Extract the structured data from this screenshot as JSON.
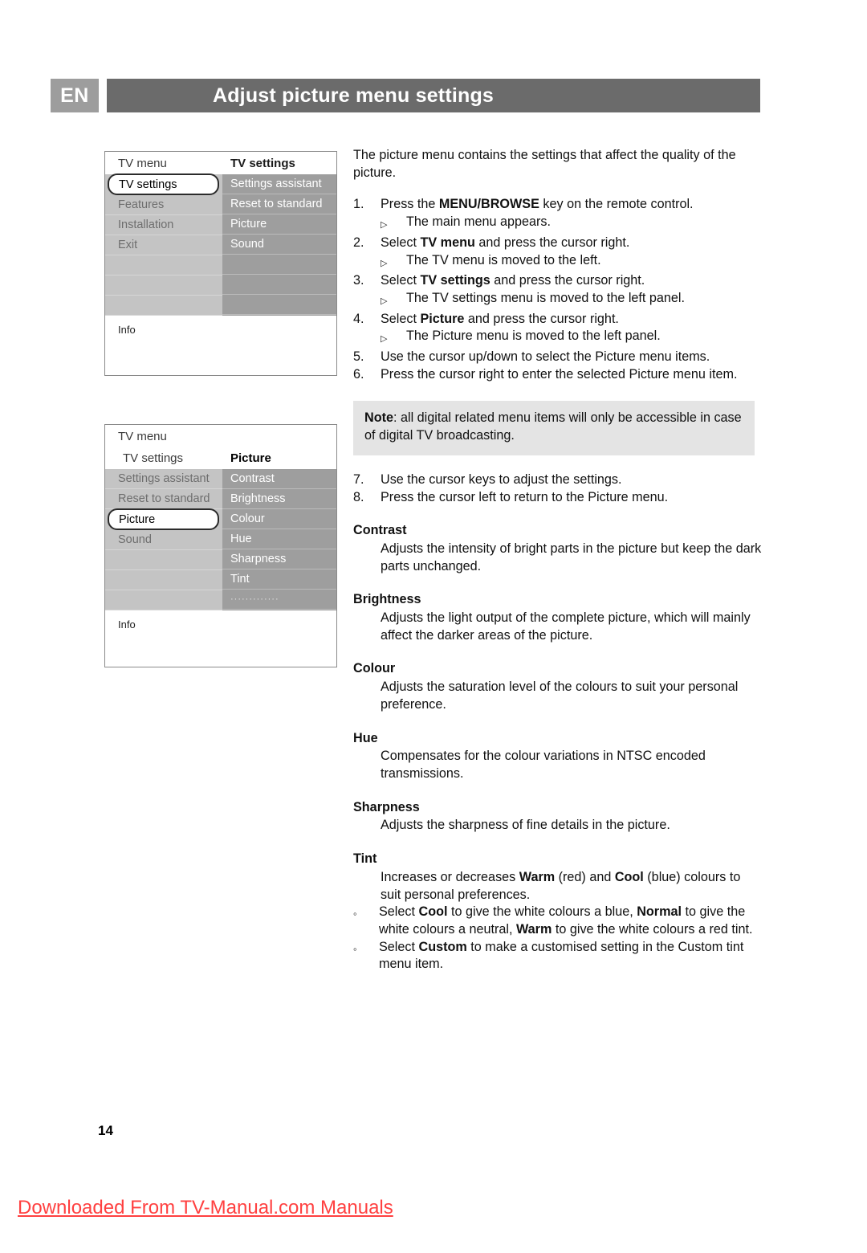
{
  "header": {
    "language": "EN",
    "title": "Adjust picture menu settings"
  },
  "tv_menu_1": {
    "left_title": "TV menu",
    "right_title": "TV settings",
    "left_items": [
      {
        "label": "TV settings",
        "state": "selected"
      },
      {
        "label": "Features",
        "state": "dim"
      },
      {
        "label": "Installation",
        "state": "dim"
      },
      {
        "label": "Exit",
        "state": "dim"
      },
      {
        "label": "",
        "state": "empty"
      },
      {
        "label": "",
        "state": "empty"
      },
      {
        "label": "",
        "state": "empty"
      }
    ],
    "right_items": [
      {
        "label": "Settings assistant",
        "state": "light"
      },
      {
        "label": "Reset to standard",
        "state": "light"
      },
      {
        "label": "Picture",
        "state": "light"
      },
      {
        "label": "Sound",
        "state": "light"
      },
      {
        "label": "",
        "state": "empty"
      },
      {
        "label": "",
        "state": "empty"
      },
      {
        "label": "",
        "state": "empty"
      }
    ],
    "info_label": "Info"
  },
  "tv_menu_2": {
    "top_title": "TV menu",
    "sub_left_title": "TV settings",
    "sub_right_title": "Picture",
    "left_items": [
      {
        "label": "Settings assistant",
        "state": "dim"
      },
      {
        "label": "Reset to standard",
        "state": "dim"
      },
      {
        "label": "Picture",
        "state": "selected"
      },
      {
        "label": "Sound",
        "state": "dim"
      },
      {
        "label": "",
        "state": "empty"
      },
      {
        "label": "",
        "state": "empty"
      },
      {
        "label": "",
        "state": "empty"
      }
    ],
    "right_items": [
      {
        "label": "Contrast",
        "state": "light"
      },
      {
        "label": "Brightness",
        "state": "light"
      },
      {
        "label": "Colour",
        "state": "light"
      },
      {
        "label": "Hue",
        "state": "light"
      },
      {
        "label": "Sharpness",
        "state": "light"
      },
      {
        "label": "Tint",
        "state": "light"
      },
      {
        "label": "·············",
        "state": "dots"
      }
    ],
    "info_label": "Info"
  },
  "content": {
    "intro": "The picture menu contains the settings that affect the quality of the picture.",
    "steps": [
      {
        "num": "1.",
        "text_pre": "Press the ",
        "text_bold": "MENU/BROWSE",
        "text_post": " key on the remote control.",
        "sub": "The main menu appears."
      },
      {
        "num": "2.",
        "text_pre": "Select ",
        "text_bold": "TV menu",
        "text_post": " and press the cursor right.",
        "sub": "The TV menu is moved to the left."
      },
      {
        "num": "3.",
        "text_pre": "Select ",
        "text_bold": "TV settings",
        "text_post": " and press the cursor right.",
        "sub": "The TV settings menu is moved to the left panel."
      },
      {
        "num": "4.",
        "text_pre": "Select ",
        "text_bold": "Picture",
        "text_post": " and press the cursor right.",
        "sub": "The Picture menu is moved to the left panel."
      },
      {
        "num": "5.",
        "text_pre": "Use the cursor up/down to select the Picture menu items.",
        "text_bold": "",
        "text_post": "",
        "sub": ""
      },
      {
        "num": "6.",
        "text_pre": "Press the cursor right to enter the selected Picture menu item.",
        "text_bold": "",
        "text_post": "",
        "sub": ""
      }
    ],
    "note": {
      "label": "Note",
      "text": ": all digital related menu items will only be accessible in case of digital TV broadcasting."
    },
    "steps2": [
      {
        "num": "7.",
        "text": "Use the cursor keys to adjust the settings."
      },
      {
        "num": "8.",
        "text": "Press the cursor left to return to the Picture menu."
      }
    ],
    "terms": [
      {
        "name": "Contrast",
        "definition": "Adjusts the intensity of bright parts in the picture but keep the dark parts unchanged."
      },
      {
        "name": "Brightness",
        "definition": "Adjusts the light output of the complete picture, which will mainly affect the darker areas of the picture."
      },
      {
        "name": "Colour",
        "definition": "Adjusts the saturation level of the colours to suit your personal preference."
      },
      {
        "name": "Hue",
        "definition": "Compensates for the colour variations in NTSC encoded transmissions."
      },
      {
        "name": "Sharpness",
        "definition": "Adjusts the sharpness of fine details in the picture."
      }
    ],
    "tint": {
      "name": "Tint",
      "line1_a": "Increases or decreases ",
      "line1_b": "Warm",
      "line1_c": " (red) and ",
      "line1_d": "Cool",
      "line1_e": " (blue) colours to suit personal preferences.",
      "bullet1_a": "Select ",
      "bullet1_b": "Cool",
      "bullet1_c": " to give the white colours a blue, ",
      "bullet1_d": "Normal",
      "bullet1_e": " to give the white colours a neutral, ",
      "bullet1_f": "Warm",
      "bullet1_g": " to give the white colours a red tint.",
      "bullet2_a": "Select ",
      "bullet2_b": "Custom",
      "bullet2_c": " to make a customised setting in the Custom tint menu item."
    }
  },
  "footer": {
    "page_number": "14",
    "watermark": "Downloaded From TV-Manual.com Manuals"
  },
  "colors": {
    "header_bar": "#6b6b6b",
    "lang_badge": "#9d9d9d",
    "menu_left_panel": "#c4c4c4",
    "menu_right_panel": "#9e9e9e",
    "note_bg": "#e4e4e4",
    "watermark": "#ff4040"
  }
}
